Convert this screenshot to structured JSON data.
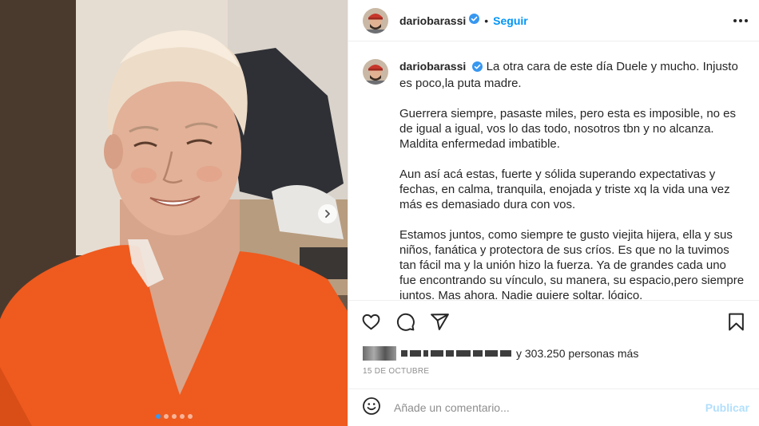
{
  "post": {
    "username": "dariobarassi",
    "separator": "•",
    "follow_label": "Seguir",
    "carousel": {
      "slides": 5,
      "active_slide": 1
    }
  },
  "caption": {
    "username": "dariobarassi",
    "paragraphs": [
      "La otra cara de este día Duele y mucho. Injusto es poco,la puta madre.",
      "Guerrera siempre, pasaste miles, pero esta es imposible, no es de igual a igual, vos lo das todo, nosotros tbn y no alcanza. Maldita enfermedad imbatible.",
      "Aun así acá estas, fuerte y sólida superando expectativas y fechas, en calma, tranquila, enojada y triste xq la vida una vez más es demasiado dura con vos.",
      "Estamos juntos, como siempre te gusto viejita hijera, ella y sus niños, fanática y protectora de sus críos. Es que no la tuvimos tan fácil ma y la unión hizo la fuerza. Ya de grandes cada uno fue encontrando su vínculo, su manera, su espacio,pero siempre juntos. Mas ahora. Nadie quiere soltar, lógico."
    ]
  },
  "likes": {
    "text": "y 303.250 personas más"
  },
  "date": "15 DE OCTUBRE",
  "comment": {
    "placeholder": "Añade un comentario...",
    "publish_label": "Publicar"
  },
  "colors": {
    "accent": "#0095f6",
    "verified": "#3897f0",
    "publish_disabled": "#b2dffc",
    "shirt": "#ef5a1e"
  },
  "icons": [
    "chevron-right-icon",
    "verified-badge-icon",
    "more-options-icon",
    "heart-icon",
    "comment-icon",
    "share-icon",
    "bookmark-icon",
    "emoji-icon"
  ]
}
